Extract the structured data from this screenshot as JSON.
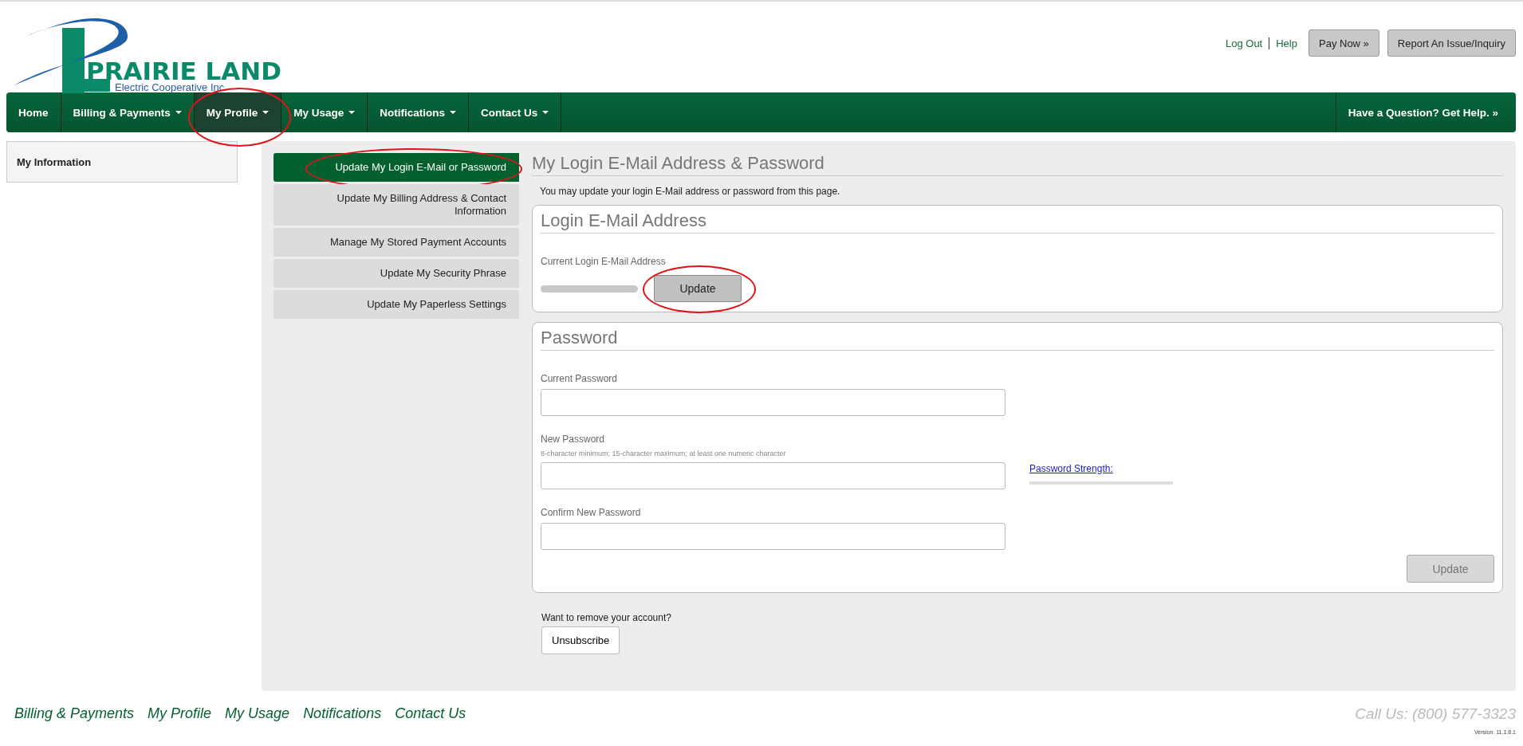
{
  "logo": {
    "name": "PRAIRIE LAND",
    "tagline": "Electric Cooperative Inc."
  },
  "header_links": [
    "Log Out",
    "Help"
  ],
  "header_buttons": [
    "Pay Now »",
    "Report An Issue/Inquiry"
  ],
  "nav": [
    {
      "label": "Home",
      "dropdown": false,
      "selected": false,
      "circled": false
    },
    {
      "label": "Billing & Payments",
      "dropdown": true,
      "selected": false,
      "circled": false
    },
    {
      "label": "My Profile",
      "dropdown": true,
      "selected": true,
      "circled": true
    },
    {
      "label": "My Usage",
      "dropdown": true,
      "selected": false,
      "circled": false
    },
    {
      "label": "Notifications",
      "dropdown": true,
      "selected": false,
      "circled": false
    },
    {
      "label": "Contact Us",
      "dropdown": true,
      "selected": false,
      "circled": false
    }
  ],
  "nav_help": "Have a Question? Get Help. »",
  "sidebar": {
    "title": "My Information"
  },
  "side_menu": [
    {
      "label": "Update My Login E-Mail or Password",
      "selected": true,
      "circled": true
    },
    {
      "label": "Update My Billing Address & Contact Information",
      "selected": false,
      "circled": false
    },
    {
      "label": "Manage My Stored Payment Accounts",
      "selected": false,
      "circled": false
    },
    {
      "label": "Update My Security Phrase",
      "selected": false,
      "circled": false
    },
    {
      "label": "Update My Paperless Settings",
      "selected": false,
      "circled": false
    }
  ],
  "page_title": "My Login E-Mail Address & Password",
  "description": "You may update your login E-Mail address or password from this page.",
  "email_card": {
    "title": "Login E-Mail Address",
    "label": "Current Login E-Mail Address",
    "value_redacted": true,
    "button": {
      "label": "Update",
      "circled": true
    }
  },
  "password_card": {
    "title": "Password",
    "fields": [
      {
        "label": "Current Password"
      },
      {
        "label": "New Password",
        "hint": "8-character minimum; 15-character maximum; at least one numeric character",
        "strength_link": "Password Strength:"
      },
      {
        "label": "Confirm New Password"
      }
    ],
    "button": {
      "label": "Update",
      "disabled": true
    }
  },
  "unsubscribe": {
    "prompt": "Want to remove your account?",
    "button": "Unsubscribe"
  },
  "footer": {
    "links": [
      "Billing & Payments",
      "My Profile",
      "My Usage",
      "Notifications",
      "Contact Us"
    ],
    "phone": "Call Us: (800) 577-3323",
    "version": "Version: 11.1.8.1"
  }
}
